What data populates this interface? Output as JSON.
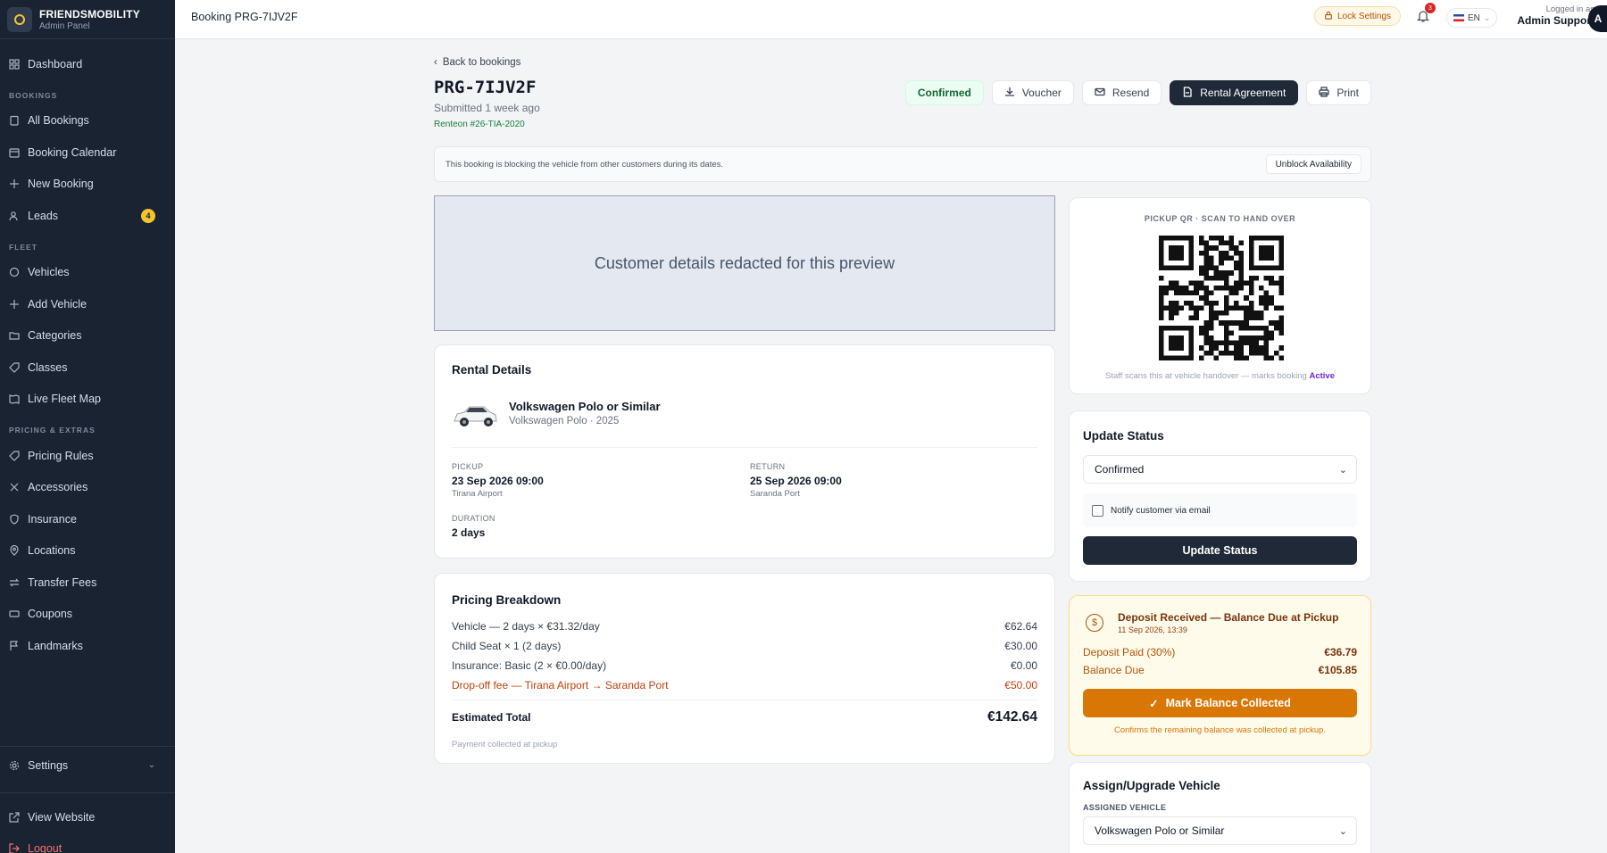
{
  "brand": {
    "name": "FRIENDSMOBILITY",
    "sub": "Admin Panel"
  },
  "sidebar": {
    "dashboard": "Dashboard",
    "sections": {
      "bookings": "BOOKINGS",
      "fleet": "FLEET",
      "pricing": "PRICING & EXTRAS"
    },
    "items": {
      "all_bookings": "All Bookings",
      "booking_calendar": "Booking Calendar",
      "new_booking": "New Booking",
      "leads": "Leads",
      "leads_badge": "4",
      "vehicles": "Vehicles",
      "add_vehicle": "Add Vehicle",
      "categories": "Categories",
      "classes": "Classes",
      "live_fleet_map": "Live Fleet Map",
      "pricing_rules": "Pricing Rules",
      "accessories": "Accessories",
      "insurance": "Insurance",
      "locations": "Locations",
      "transfer_fees": "Transfer Fees",
      "coupons": "Coupons",
      "landmarks": "Landmarks"
    },
    "settings": "Settings",
    "view_website": "View Website",
    "logout": "Logout"
  },
  "topbar": {
    "title": "Booking PRG-7IJV2F",
    "lock_settings": "Lock Settings",
    "notif_count": "3",
    "lang": "EN",
    "logged_in_as": "Logged in as",
    "user_name": "Admin Support",
    "avatar": "A"
  },
  "booking": {
    "back": "Back to bookings",
    "ref": "PRG-7IJV2F",
    "submitted": "Submitted 1 week ago",
    "renteon": "Renteon #26-TIA-2020",
    "actions": {
      "status": "Confirmed",
      "voucher": "Voucher",
      "resend": "Resend",
      "agreement": "Rental Agreement",
      "print": "Print"
    },
    "notice": "This booking is blocking the vehicle from other customers during its dates.",
    "unblock": "Unblock Availability",
    "redacted": "Customer details redacted for this preview"
  },
  "rental": {
    "title": "Rental Details",
    "vehicle_name": "Volkswagen Polo or Similar",
    "vehicle_sub": "Volkswagen Polo · 2025",
    "pickup_label": "PICKUP",
    "pickup_date": "23 Sep 2026 09:00",
    "pickup_loc": "Tirana Airport",
    "return_label": "RETURN",
    "return_date": "25 Sep 2026 09:00",
    "return_loc": "Saranda Port",
    "duration_label": "DURATION",
    "duration": "2 days"
  },
  "pricing": {
    "title": "Pricing Breakdown",
    "rows": [
      {
        "label": "Vehicle — 2 days × €31.32/day",
        "amount": "€62.64"
      },
      {
        "label": "Child Seat × 1 (2 days)",
        "amount": "€30.00"
      },
      {
        "label": "Insurance: Basic (2 × €0.00/day)",
        "amount": "€0.00"
      },
      {
        "label": "Drop-off fee — Tirana Airport → Saranda Port",
        "amount": "€50.00"
      }
    ],
    "total_label": "Estimated Total",
    "total": "€142.64",
    "note": "Payment collected at pickup"
  },
  "qr": {
    "title": "PICKUP QR · SCAN TO HAND OVER",
    "note": "Staff scans this at vehicle handover — marks booking",
    "note_status": "Active"
  },
  "update_status": {
    "title": "Update Status",
    "selected": "Confirmed",
    "notify": "Notify customer via email",
    "button": "Update Status"
  },
  "deposit": {
    "title": "Deposit Received — Balance Due at Pickup",
    "date": "11 Sep 2026, 13:39",
    "paid_label": "Deposit Paid (30%)",
    "paid": "€36.79",
    "due_label": "Balance Due",
    "due": "€105.85",
    "button": "Mark Balance Collected",
    "note": "Confirms the remaining balance was collected at pickup."
  },
  "assign": {
    "title": "Assign/Upgrade Vehicle",
    "label": "ASSIGNED VEHICLE",
    "selected": "Volkswagen Polo or Similar"
  }
}
